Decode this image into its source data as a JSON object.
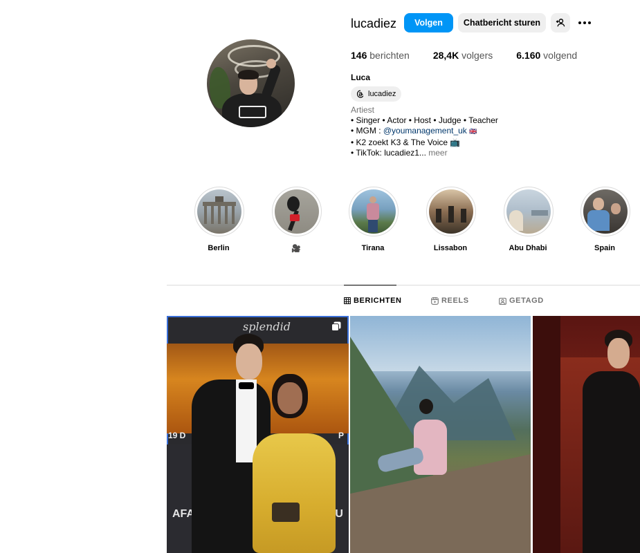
{
  "profile": {
    "username": "lucadiez",
    "follow_label": "Volgen",
    "chat_label": "Chatbericht sturen",
    "adduser_icon": "add-user-icon",
    "more_icon": "more-horizontal-icon",
    "stats": {
      "posts_value": "146",
      "posts_label": "berichten",
      "followers_value": "28,4K",
      "followers_label": "volgers",
      "following_value": "6.160",
      "following_label": "volgend"
    },
    "full_name": "Luca",
    "threads_handle": "lucadiez",
    "threads_icon": "threads-icon",
    "bio": {
      "category": "Artiest",
      "line1": "• Singer • Actor • Host • Judge • Teacher",
      "line2_prefix": "• MGM : ",
      "line2_link": "@youmanagement_uk",
      "line2_suffix": "🇬🇧",
      "line3": "• K2 zoekt K3 & The Voice 📺",
      "line4": "• TikTok: lucadiez1...",
      "more_label": "meer"
    }
  },
  "highlights": [
    {
      "label": "Berlin"
    },
    {
      "label": "🎥"
    },
    {
      "label": "Tirana"
    },
    {
      "label": "Lissabon"
    },
    {
      "label": "Abu Dhabi"
    },
    {
      "label": "Spain"
    }
  ],
  "tabs": [
    {
      "label": "BERICHTEN",
      "icon": "grid-icon",
      "active": true
    },
    {
      "label": "REELS",
      "icon": "reels-icon",
      "active": false
    },
    {
      "label": "GETAGD",
      "icon": "tagged-icon",
      "active": false
    }
  ],
  "posts": [
    {
      "id": "post-1",
      "overlay_text": "splendid",
      "multi": true,
      "left_text": "19 D",
      "right_text": "P",
      "bottom_left": "AFA",
      "bottom_right": "CLU"
    },
    {
      "id": "post-2",
      "multi": false
    },
    {
      "id": "post-3",
      "multi": false
    }
  ],
  "colors": {
    "accent": "#0095f6",
    "button_bg": "#efefef",
    "link": "#00376b",
    "muted": "#737373",
    "selection": "#3a6fd8"
  }
}
